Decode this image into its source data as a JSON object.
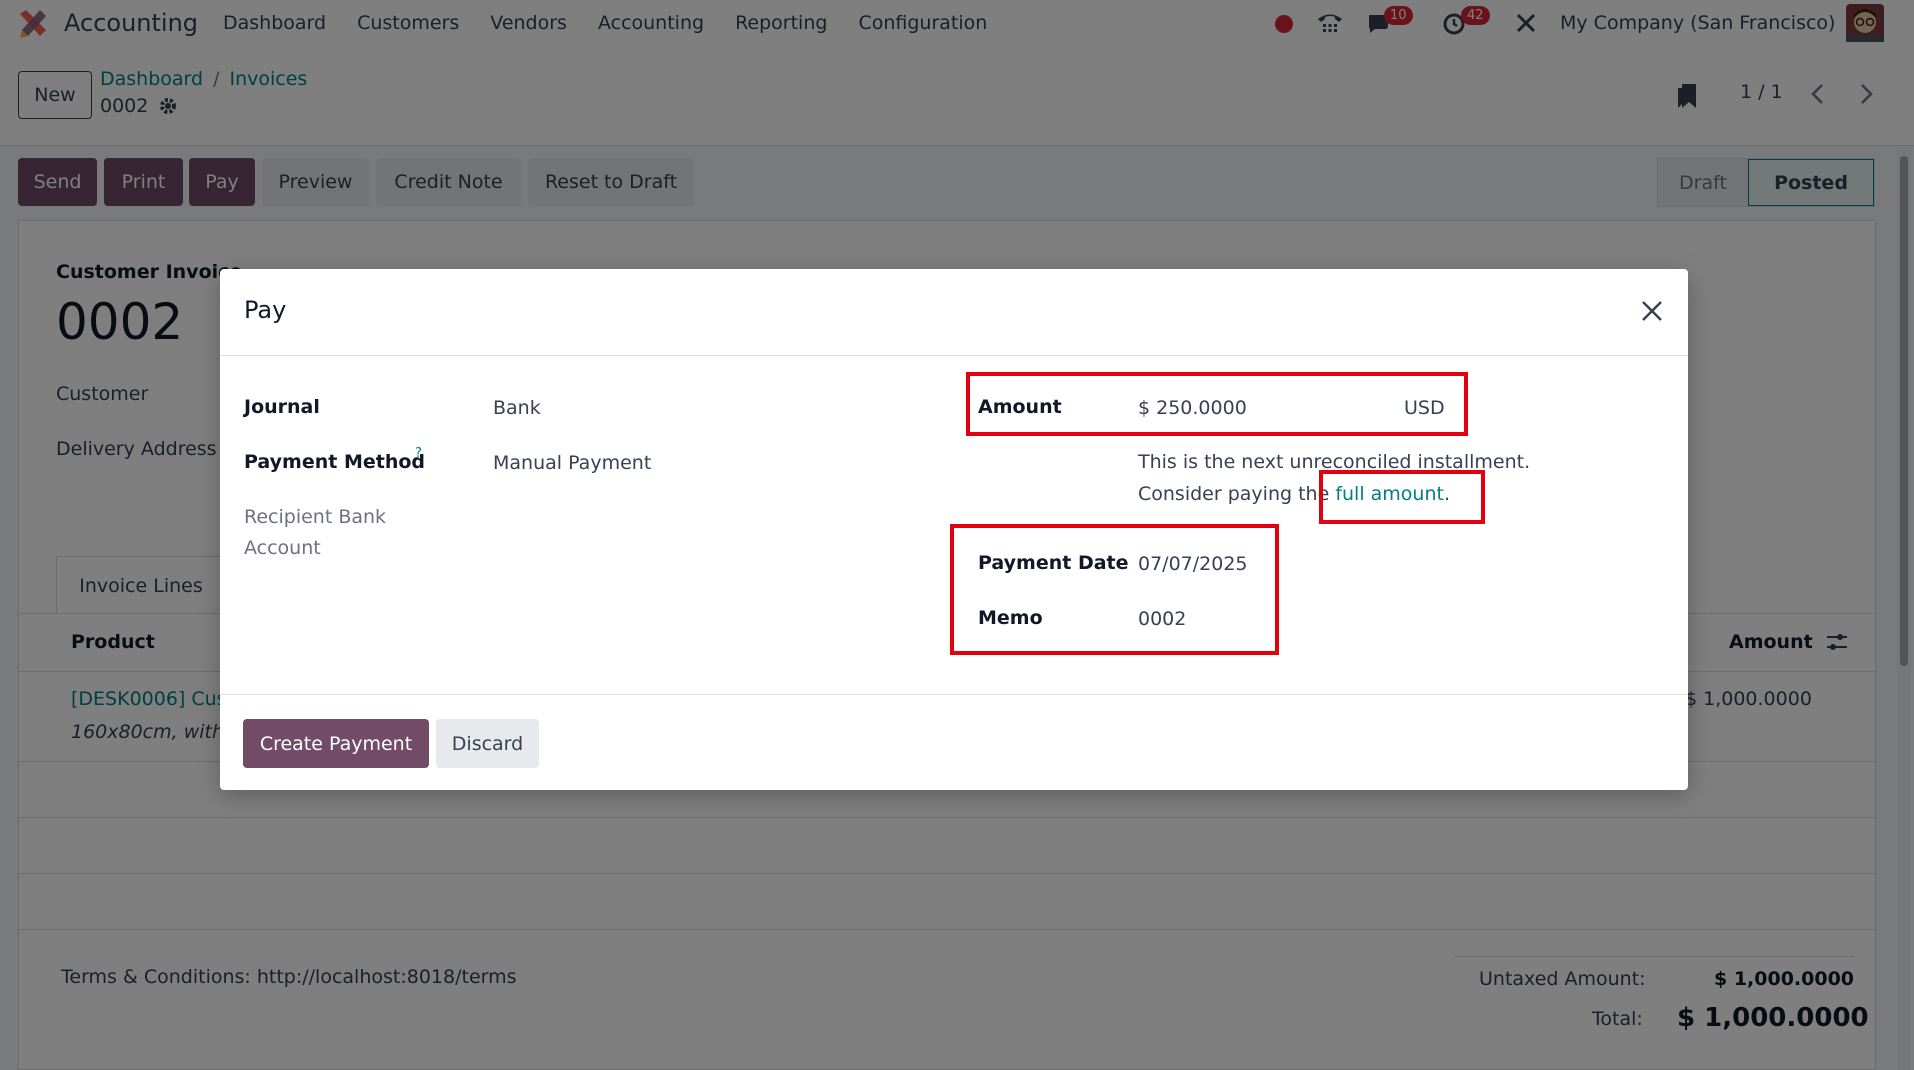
{
  "app": {
    "title": "Accounting",
    "logo_icon": "odoo-accounting-logo-icon"
  },
  "topnav": {
    "menus": [
      "Dashboard",
      "Customers",
      "Vendors",
      "Accounting",
      "Reporting",
      "Configuration"
    ],
    "messages_count": "10",
    "activities_count": "42",
    "company": "My Company (San Francisco)"
  },
  "control_panel": {
    "new_label": "New",
    "breadcrumb": [
      "Dashboard",
      "Invoices"
    ],
    "record_name": "0002",
    "pager": "1 / 1"
  },
  "action_buttons": {
    "send": "Send",
    "print": "Print",
    "pay": "Pay",
    "preview": "Preview",
    "credit_note": "Credit Note",
    "reset_to_draft": "Reset to Draft"
  },
  "statusbar": {
    "draft": "Draft",
    "posted": "Posted"
  },
  "form": {
    "move_type": "Customer Invoice",
    "number": "0002",
    "customer_label": "Customer",
    "delivery_address_label": "Delivery Address",
    "tab_invoice_lines": "Invoice Lines",
    "col_product": "Product",
    "col_amount": "Amount",
    "line_product": "[DESK0006] Cus",
    "line_description": "160x80cm, with",
    "line_amount": "$ 1,000.0000",
    "terms": "Terms & Conditions: http://localhost:8018/terms",
    "untaxed_label": "Untaxed Amount:",
    "untaxed_value": "$ 1,000.0000",
    "total_label": "Total:",
    "total_value": "$ 1,000.0000"
  },
  "modal": {
    "title": "Pay",
    "journal_label": "Journal",
    "journal_value": "Bank",
    "payment_method_label": "Payment Method",
    "payment_method_help": "?",
    "payment_method_value": "Manual Payment",
    "recipient_bank_label_1": "Recipient Bank",
    "recipient_bank_label_2": "Account",
    "amount_label": "Amount",
    "amount_value": "$ 250.0000",
    "currency": "USD",
    "installment_note": "This is the next unreconciled installment.",
    "consider_text": "Consider paying the",
    "full_amount_link": "full amount",
    "period": ".",
    "payment_date_label": "Payment Date",
    "payment_date_value": "07/07/2025",
    "memo_label": "Memo",
    "memo_value": "0002",
    "create_payment": "Create Payment",
    "discard": "Discard"
  },
  "colors": {
    "primary": "#714b67",
    "link": "#017e84",
    "highlight": "#e3000f",
    "badge": "#d6263a"
  }
}
